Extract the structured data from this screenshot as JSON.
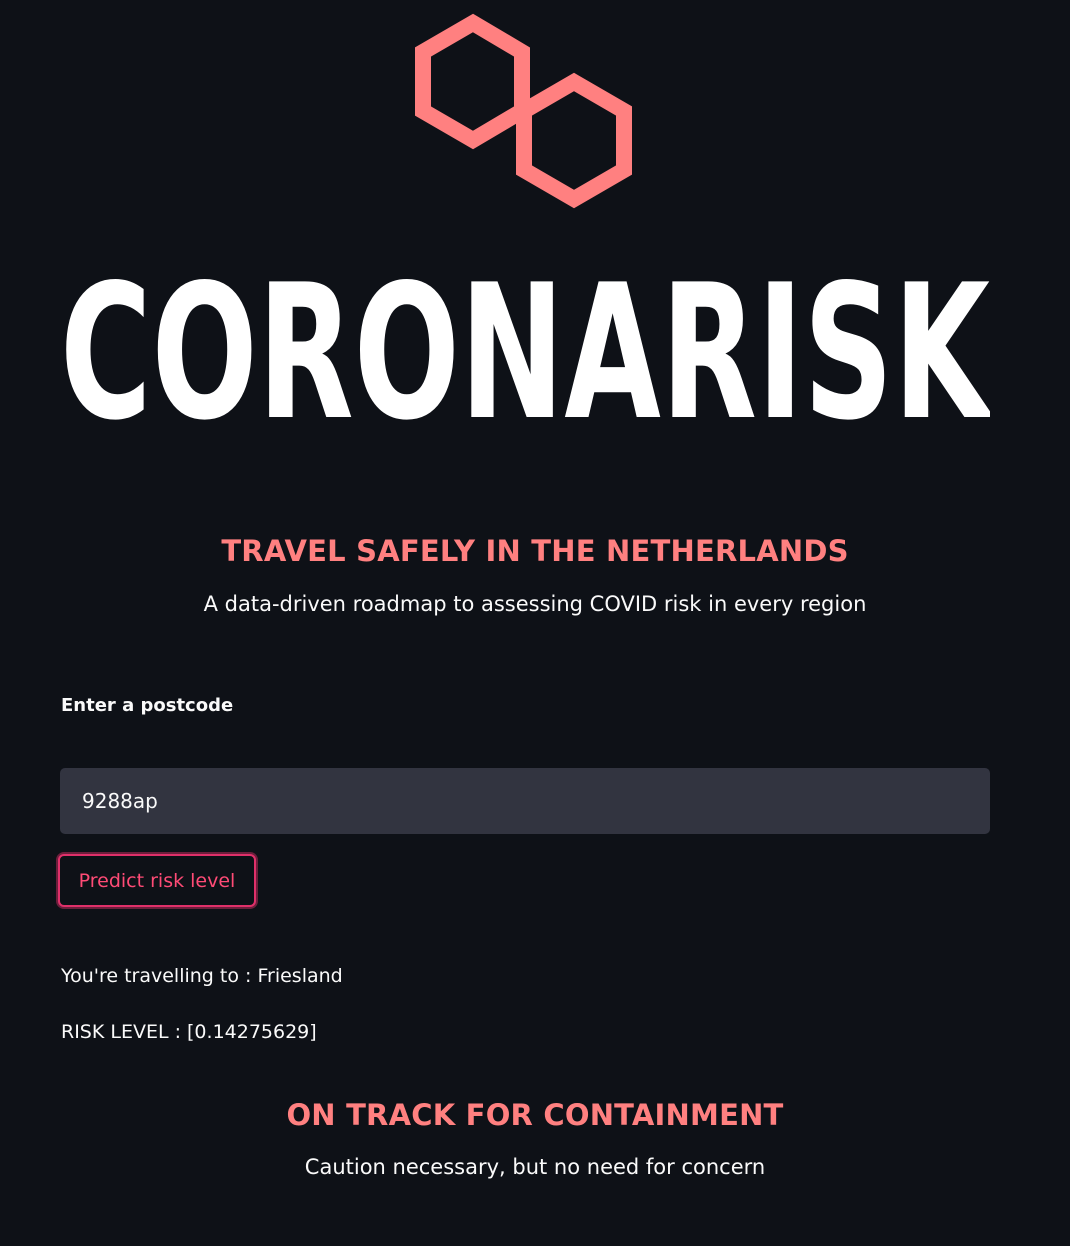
{
  "brand": {
    "logo_name": "CORONARISK",
    "accent_color": "#ff8080",
    "icon": "hexagon-pair-icon"
  },
  "headline": {
    "title": "TRAVEL SAFELY IN THE NETHERLANDS",
    "subtitle": "A data-driven roadmap to assessing COVID risk in every region"
  },
  "form": {
    "label": "Enter a postcode",
    "postcode_value": "9288ap",
    "button_label": "Predict risk level"
  },
  "result": {
    "destination_text": "You're travelling to : Friesland",
    "risk_text": "RISK LEVEL : [0.14275629]",
    "status_title": "ON TRACK FOR CONTAINMENT",
    "status_message": "Caution necessary, but no need for concern"
  }
}
